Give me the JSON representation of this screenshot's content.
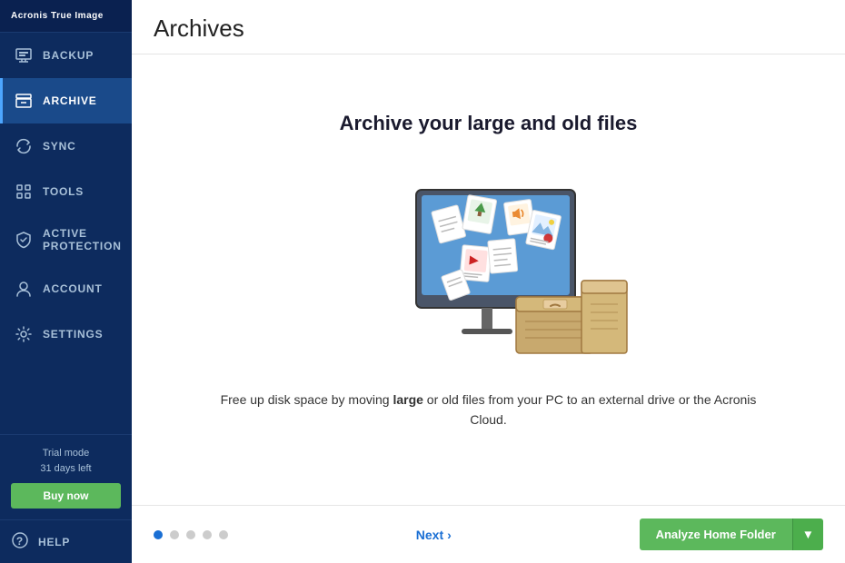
{
  "sidebar": {
    "logo": "Acronis True Image",
    "items": [
      {
        "id": "backup",
        "label": "Backup",
        "icon": "backup-icon",
        "active": false
      },
      {
        "id": "archive",
        "label": "Archive",
        "icon": "archive-icon",
        "active": true
      },
      {
        "id": "sync",
        "label": "Sync",
        "icon": "sync-icon",
        "active": false
      },
      {
        "id": "tools",
        "label": "Tools",
        "icon": "tools-icon",
        "active": false
      },
      {
        "id": "active-protection",
        "label": "Active Protection",
        "icon": "protection-icon",
        "active": false
      },
      {
        "id": "account",
        "label": "Account",
        "icon": "account-icon",
        "active": false
      },
      {
        "id": "settings",
        "label": "Settings",
        "icon": "settings-icon",
        "active": false
      }
    ],
    "trial": {
      "mode_label": "Trial mode",
      "days_label": "31 days left"
    },
    "buy_now_label": "Buy now",
    "help_label": "Help"
  },
  "main": {
    "page_title": "Archives",
    "archive_heading": "Archive your large and old files",
    "description": "Free up disk space by moving large or old files from your PC to an external drive or the Acronis Cloud.",
    "dots": [
      {
        "active": true
      },
      {
        "active": false
      },
      {
        "active": false
      },
      {
        "active": false
      },
      {
        "active": false
      }
    ],
    "next_label": "Next",
    "analyze_btn_label": "Analyze Home Folder",
    "colors": {
      "accent_blue": "#1a6fd4",
      "accent_green": "#5cb85c"
    }
  }
}
